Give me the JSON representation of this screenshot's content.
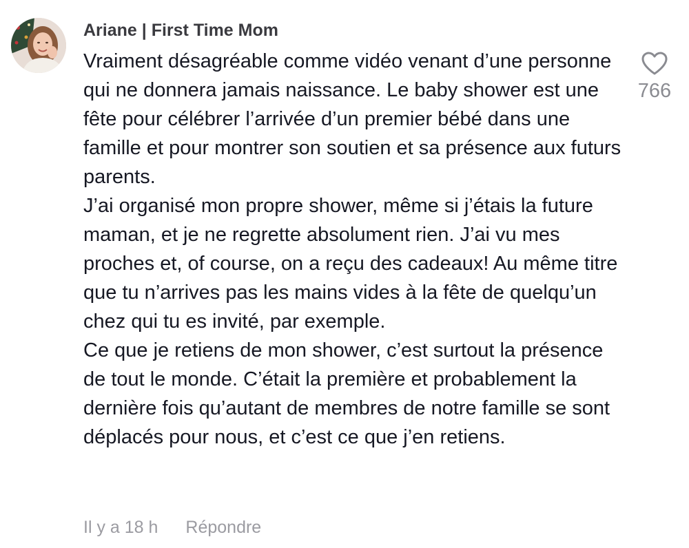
{
  "comment": {
    "author": "Ariane | First Time Mom",
    "paragraphs": [
      "Vraiment désagréable comme vidéo venant d’une personne qui ne donnera jamais naissance. Le baby shower est une fête pour célébrer l’arrivée d’un premier bébé dans une famille et pour montrer son soutien et sa présence aux futurs parents.",
      "J’ai organisé mon propre shower, même si j’étais la future maman, et je ne regrette absolument rien. J’ai vu mes proches et, of course, on a reçu des cadeaux! Au même titre que tu n’arrives pas les mains vides à la fête de quelqu’un chez qui tu es invité, par exemple.",
      "Ce que je retiens de mon shower, c’est surtout la présence de tout le monde. C’était la première et probablement la dernière fois qu’autant de membres de notre famille se sont déplacés pour nous, et c’est ce que j’en retiens."
    ],
    "timestamp": "Il y a 18 h",
    "reply_label": "Répondre",
    "like_count": "766",
    "like_icon": "heart-outline-icon"
  },
  "colors": {
    "text": "#161823",
    "author": "#3a3a3f",
    "muted": "#9b9ba1",
    "like_count": "#8a8b91"
  }
}
